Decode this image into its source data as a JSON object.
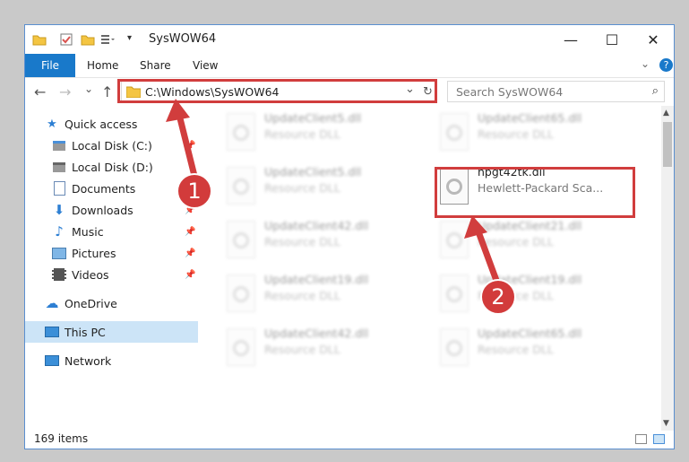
{
  "window": {
    "title": "SysWOW64",
    "controls": {
      "minimize": "—",
      "maximize": "☐",
      "close": "✕"
    }
  },
  "ribbon": {
    "tabs": [
      "File",
      "Home",
      "Share",
      "View"
    ],
    "expand_icon": "chevron-down-icon",
    "help_icon": "help-icon"
  },
  "navigation": {
    "back": "←",
    "forward": "→",
    "recent": "⌄",
    "up": "↑"
  },
  "address": {
    "path": "C:\\Windows\\SysWOW64",
    "dropdown": "⌄",
    "refresh": "↻"
  },
  "search": {
    "placeholder": "Search SysWOW64"
  },
  "sidebar": {
    "items": [
      {
        "label": "Quick access",
        "icon": "star-icon",
        "pinned": false
      },
      {
        "label": "Local Disk (C:)",
        "icon": "drive-icon",
        "pinned": true
      },
      {
        "label": "Local Disk (D:)",
        "icon": "drive-icon",
        "pinned": false
      },
      {
        "label": "Documents",
        "icon": "documents-icon",
        "pinned": true
      },
      {
        "label": "Downloads",
        "icon": "download-icon",
        "pinned": true
      },
      {
        "label": "Music",
        "icon": "music-icon",
        "pinned": true
      },
      {
        "label": "Pictures",
        "icon": "pictures-icon",
        "pinned": true
      },
      {
        "label": "Videos",
        "icon": "video-icon",
        "pinned": true
      },
      {
        "label": "OneDrive",
        "icon": "cloud-icon",
        "pinned": false
      },
      {
        "label": "This PC",
        "icon": "computer-icon",
        "pinned": false,
        "selected": true
      },
      {
        "label": "Network",
        "icon": "network-icon",
        "pinned": false
      }
    ]
  },
  "files": [
    {
      "name": "UpdateClient5.dll",
      "desc": "Resource DLL",
      "blurred": true
    },
    {
      "name": "UpdateClient65.dll",
      "desc": "Resource DLL",
      "blurred": true
    },
    {
      "name": "UpdateClient5.dll",
      "desc": "Resource DLL",
      "blurred": true
    },
    {
      "name": "hpgt42tk.dll",
      "desc": "Hewlett-Packard Sca...",
      "blurred": false
    },
    {
      "name": "UpdateClient42.dll",
      "desc": "Resource DLL",
      "blurred": true
    },
    {
      "name": "UpdateClient21.dll",
      "desc": "Resource DLL",
      "blurred": true
    },
    {
      "name": "UpdateClient19.dll",
      "desc": "Resource DLL",
      "blurred": true
    },
    {
      "name": "UpdateClient19.dll",
      "desc": "Resource DLL",
      "blurred": true
    },
    {
      "name": "UpdateClient42.dll",
      "desc": "Resource DLL",
      "blurred": true
    },
    {
      "name": "UpdateClient65.dll",
      "desc": "Resource DLL",
      "blurred": true
    }
  ],
  "status": {
    "items_count": "169 items"
  },
  "annotations": {
    "step1": "1",
    "step2": "2",
    "highlight_color": "#d13d3d"
  }
}
